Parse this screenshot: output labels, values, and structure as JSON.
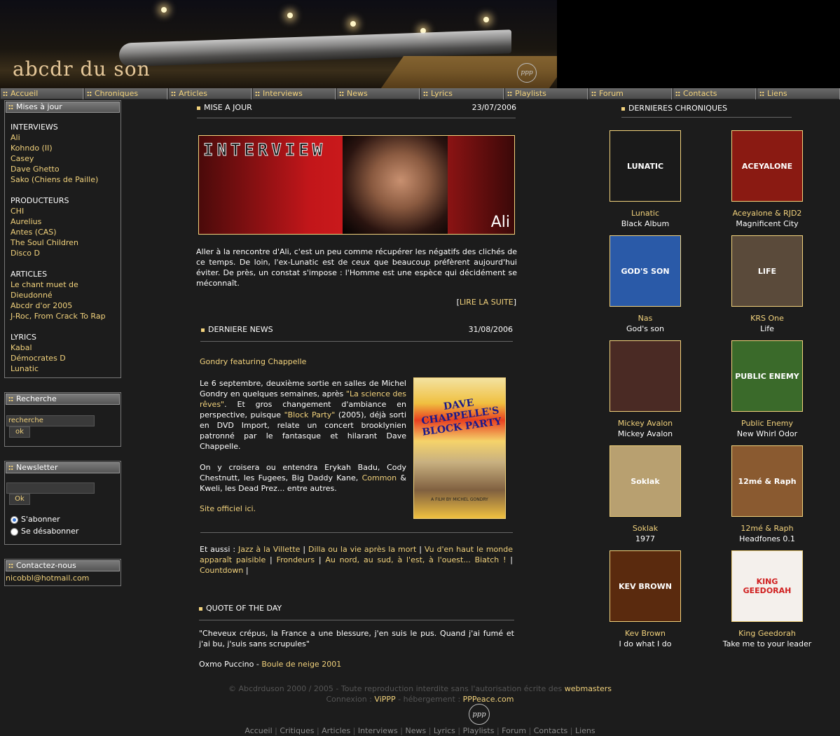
{
  "header": {
    "logo": "abcdr du son",
    "emblem": "ppp"
  },
  "nav": [
    "Accueil",
    "Chroniques",
    "Articles",
    "Interviews",
    "News",
    "Lyrics",
    "Playlists",
    "Forum",
    "Contacts",
    "Liens"
  ],
  "sidebar": {
    "updates": {
      "title": "Mises à jour",
      "groups": [
        {
          "label": "INTERVIEWS",
          "items": [
            "Ali",
            "Kohndo (II)",
            "Casey",
            "Dave Ghetto",
            "Sako (Chiens de Paille)"
          ]
        },
        {
          "label": "PRODUCTEURS",
          "items": [
            "CHI",
            "Aurelius",
            "Antes (CAS)",
            "The Soul Children",
            "Disco D"
          ]
        },
        {
          "label": "ARTICLES",
          "items": [
            "Le chant muet de Dieudonné",
            "Abcdr d'or 2005",
            "J-Roc, From Crack To Rap"
          ]
        },
        {
          "label": "LYRICS",
          "items": [
            "Kabal",
            "Démocrates D",
            "Lunatic"
          ]
        }
      ]
    },
    "search": {
      "title": "Recherche",
      "value": "recherche",
      "button": "ok"
    },
    "newsletter": {
      "title": "Newsletter",
      "button": "Ok",
      "subscribe": "S'abonner",
      "unsubscribe": "Se désabonner"
    },
    "contact": {
      "title": "Contactez-nous",
      "email": "nicobbl@hotmail.com"
    }
  },
  "main": {
    "update": {
      "title": "MISE A JOUR",
      "date": "23/07/2006",
      "banner_word": "INTERVIEW",
      "banner_name": "Ali",
      "text": "Aller à la rencontre d'Ali, c'est un peu comme récupérer les négatifs des clichés de ce temps. De loin, l'ex-Lunatic est de ceux que beaucoup préfèrent aujourd'hui éviter. De près, un constat s'impose : l'Homme est une espèce qui décidément se méconnaît.",
      "read_more": "LIRE LA SUITE",
      "bracket_open": "[",
      "bracket_close": "]"
    },
    "news": {
      "title": "DERNIERE NEWS",
      "date": "31/08/2006",
      "headline": "Gondry featuring Chappelle",
      "p1_a": "Le 6 septembre, deuxième sortie en salles de Michel Gondry en quelques semaines, après ",
      "p1_link1": "\"La science des rêves\"",
      "p1_b": ". Et gros changement d'ambiance en perspective, puisque ",
      "p1_link2": "\"Block Party\"",
      "p1_c": " (2005), déjà sorti en DVD Import, relate un concert brooklynien patronné par le fantasque et hilarant Dave Chappelle.",
      "p2_a": "On y croisera ou entendra Erykah Badu, Cody Chestnutt, les Fugees, Big Daddy Kane, ",
      "p2_link": "Common",
      "p2_b": " & Kweli, les Dead Prez... entre autres.",
      "site_link": "Site officiel ici.",
      "poster_title": "DAVE CHAPPELLE'S BLOCK PARTY",
      "poster_sub": "A FILM BY MICHEL GONDRY",
      "also_label": "Et aussi : ",
      "also_links": [
        "Jazz à la Villette",
        "Dilla ou la vie après la mort",
        "Vu d'en haut le monde apparaît paisible",
        "Frondeurs",
        "Au nord, au sud, à l'est, à l'ouest... Biatch !",
        "Countdown"
      ]
    },
    "quote": {
      "title": "QUOTE OF THE DAY",
      "text": "\"Cheveux crépus, la France a une blessure, j'en suis le pus. Quand j'ai fumé et j'ai bu, j'suis sans scrupules\"",
      "author": "Oxmo Puccino",
      "separator": " - ",
      "source": "Boule de neige 2001"
    }
  },
  "chroniques": {
    "title": "DERNIERES CHRONIQUES",
    "albums": [
      {
        "artist": "Lunatic",
        "title": "Black Album",
        "cover_text": "LUNATIC",
        "bg": "#1a1a1a"
      },
      {
        "artist": "Aceyalone & RJD2",
        "title": "Magnificent City",
        "cover_text": "ACEYALONE",
        "bg": "#8a1a12"
      },
      {
        "artist": "Nas",
        "title": "God's son",
        "cover_text": "GOD'S SON",
        "bg": "#2a5aa8"
      },
      {
        "artist": "KRS One",
        "title": "Life",
        "cover_text": "LIFE",
        "bg": "#5a4a3a"
      },
      {
        "artist": "Mickey Avalon",
        "title": "Mickey Avalon",
        "cover_text": "",
        "bg": "#4a2a24"
      },
      {
        "artist": "Public Enemy",
        "title": "New Whirl Odor",
        "cover_text": "PUBLIC ENEMY",
        "bg": "#3a6a2a"
      },
      {
        "artist": "Soklak",
        "title": "1977",
        "cover_text": "Soklak",
        "bg": "#b8a070"
      },
      {
        "artist": "12mé & Raph",
        "title": "Headfones 0.1",
        "cover_text": "12mé & Raph",
        "bg": "#8a5a30"
      },
      {
        "artist": "Kev Brown",
        "title": "I do what I do",
        "cover_text": "KEV BROWN",
        "bg": "#5a2a0e"
      },
      {
        "artist": "King Geedorah",
        "title": "Take me to your leader",
        "cover_text": "KING GEEDORAH",
        "bg": "#f4f0ec"
      }
    ]
  },
  "footer": {
    "line1_a": "© Abcdrduson 2000 / 2005 - Toute reproduction interdite sans l'autorisation écrite des ",
    "line1_link": "webmasters",
    "line2_a": "Connexion : ",
    "line2_link1": "ViPPP",
    "line2_b": " - hébergement : ",
    "line2_link2": "PPPeace.com",
    "emblem": "ppp",
    "nav": [
      "Accueil",
      "Critiques",
      "Articles",
      "Interviews",
      "News",
      "Lyrics",
      "Playlists",
      "Forum",
      "Contacts",
      "Liens"
    ]
  }
}
